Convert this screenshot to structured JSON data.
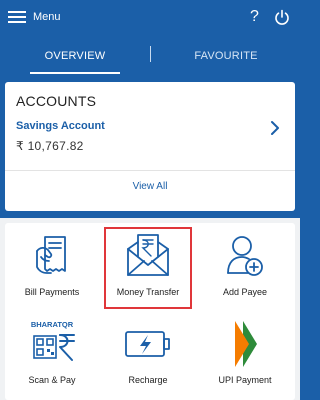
{
  "header": {
    "menu_label": "Menu",
    "help_glyph": "?",
    "icons": [
      "hamburger-icon",
      "help-icon",
      "power-icon"
    ]
  },
  "tabs": [
    {
      "label": "OVERVIEW",
      "active": true
    },
    {
      "label": "FAVOURITE",
      "active": false
    }
  ],
  "accounts": {
    "title": "ACCOUNTS",
    "account_name": "Savings Account",
    "balance": "₹ 10,767.82",
    "view_all": "View All"
  },
  "quick_actions": [
    {
      "label": "Bill Payments",
      "icon": "bill-payments-icon"
    },
    {
      "label": "Money Transfer",
      "icon": "money-transfer-icon",
      "highlighted": true
    },
    {
      "label": "Add Payee",
      "icon": "add-payee-icon"
    },
    {
      "label": "Scan & Pay",
      "icon": "bharat-qr-icon",
      "icon_text": "BHARATQR"
    },
    {
      "label": "Recharge",
      "icon": "battery-recharge-icon"
    },
    {
      "label": "UPI Payment",
      "icon": "upi-logo-icon"
    }
  ],
  "colors": {
    "primary_blue": "#1b5fa8",
    "highlight_red": "#e0363a",
    "background_light": "#f0f2f4",
    "upi_orange": "#f57c00",
    "upi_green": "#2e8b3a"
  }
}
